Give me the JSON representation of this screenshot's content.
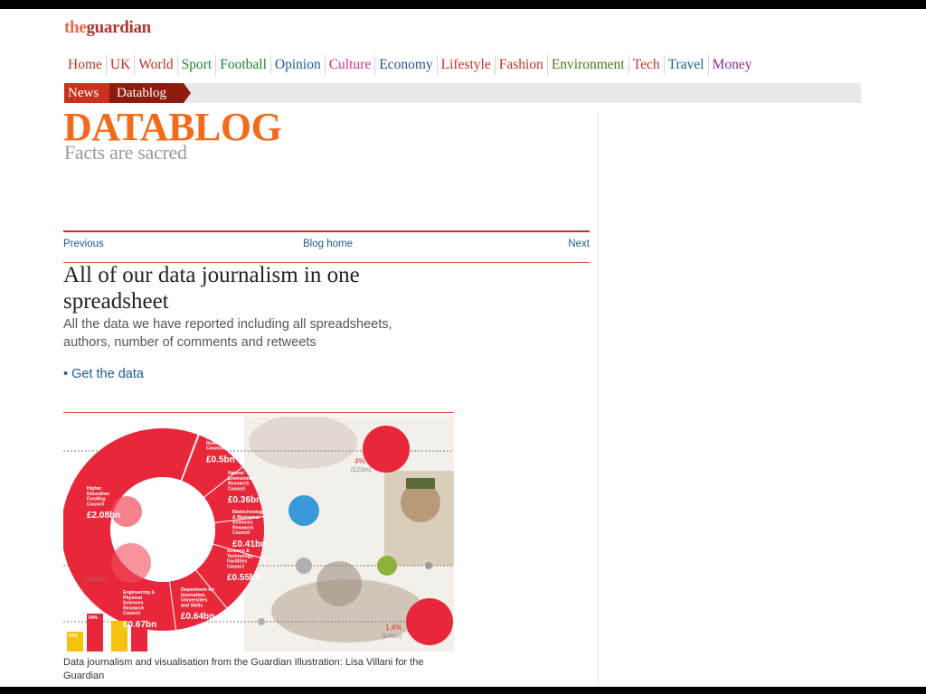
{
  "logo": {
    "the": "the",
    "guardian": "guardian"
  },
  "nav": [
    {
      "label": "Home",
      "color": "#c8321f"
    },
    {
      "label": "UK",
      "color": "#c8321f"
    },
    {
      "label": "World",
      "color": "#c8321f"
    },
    {
      "label": "Sport",
      "color": "#1d8a2c"
    },
    {
      "label": "Football",
      "color": "#1d8a2c"
    },
    {
      "label": "Opinion",
      "color": "#1a5a96"
    },
    {
      "label": "Culture",
      "color": "#d1308a"
    },
    {
      "label": "Economy",
      "color": "#27509b"
    },
    {
      "label": "Lifestyle",
      "color": "#c8321f"
    },
    {
      "label": "Fashion",
      "color": "#c8321f"
    },
    {
      "label": "Environment",
      "color": "#3a7d1c"
    },
    {
      "label": "Tech",
      "color": "#c8321f"
    },
    {
      "label": "Travel",
      "color": "#1a5a96"
    },
    {
      "label": "Money",
      "color": "#8a2a9a"
    }
  ],
  "breadcrumb": {
    "news": "News",
    "datablog": "Datablog"
  },
  "datablog": {
    "title": "DATABLOG",
    "subtitle": "Facts are sacred"
  },
  "pager": {
    "previous": "Previous",
    "home": "Blog home",
    "next": "Next"
  },
  "article": {
    "headline": "All of our data journalism in one spreadsheet",
    "standfirst": "All the data we have reported including all spreadsheets, authors, number of comments and retweets",
    "get_data": "• Get the data"
  },
  "graphic": {
    "segments": [
      {
        "name": "Higher Education Funding Council",
        "value": "£2.08bn"
      },
      {
        "name": "Medical Research Council",
        "value": "£0.5bn"
      },
      {
        "name": "Natural Environment Research Council",
        "value": "£0.36bn"
      },
      {
        "name": "Biotechnology & Biological Sciences Research Council",
        "value": "£0.41bn"
      },
      {
        "name": "Science & Technology Facilities Council",
        "value": "£0.55bn"
      },
      {
        "name": "Department for Innovation, Universities and Skills",
        "value": "£0.64bn"
      },
      {
        "name": "Engineering & Physical Sciences Research Council",
        "value": "£0.67bn"
      }
    ],
    "annotations": [
      {
        "pct": "4%",
        "sub": "(£23m)"
      },
      {
        "pct": "1.4%",
        "sub": "(£46m)"
      },
      {
        "pct": "6.8%",
        "sub": "(£29bn)"
      }
    ],
    "bar_labels": [
      "54%",
      "64%"
    ]
  },
  "caption": "Data journalism and visualisation from the Guardian Illustration: Lisa Villani for the Guardian"
}
